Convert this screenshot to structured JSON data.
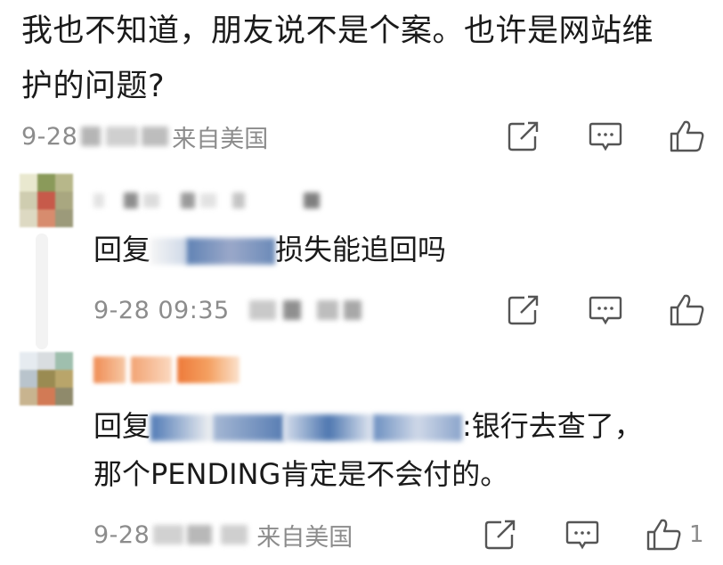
{
  "comments": [
    {
      "body_line1": "我也不知道，朋友说不是个案。也许是网站维",
      "body_line2": "护的问题?",
      "time": "9-28",
      "location": "来自美国"
    }
  ],
  "replies": [
    {
      "prefix": "回复",
      "text": "损失能追回吗",
      "time": "9-28 09:35"
    },
    {
      "prefix": "回复",
      "text_line1_suffix": ":银行去查了，",
      "text_line2": "那个PENDING肯定是不会付的。",
      "time": "9-28",
      "location": "来自美国",
      "like_count": "1"
    }
  ],
  "icons": [
    "share-icon",
    "comment-icon",
    "like-icon"
  ],
  "colors": {
    "text": "#1a1a1a",
    "meta": "#8c8c8c",
    "icon": "#555555"
  }
}
